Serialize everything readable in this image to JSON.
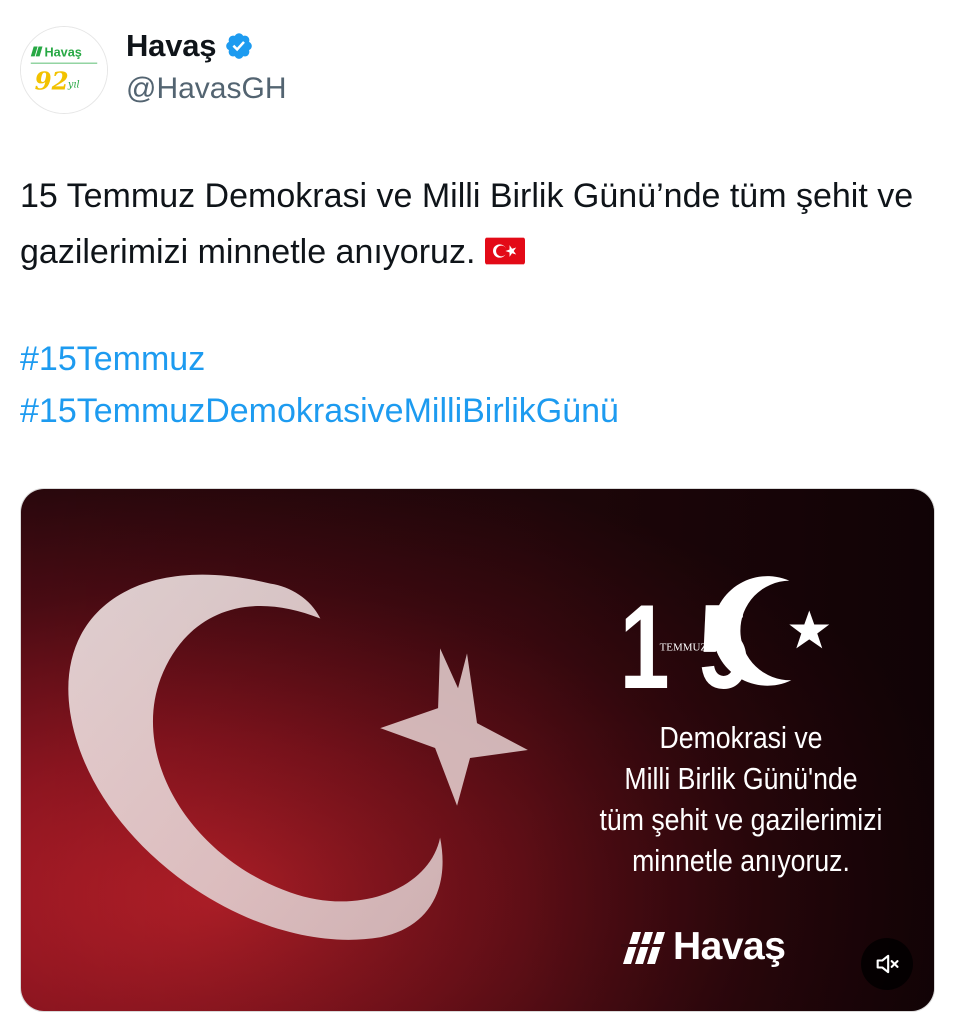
{
  "author": {
    "display_name": "Havaş",
    "handle": "@HavasGH",
    "verified_icon": "verified-badge-icon",
    "avatar": {
      "brand_text": "Havaş",
      "anniversary_number": "92",
      "anniversary_suffix": "yıl"
    }
  },
  "tweet": {
    "text": "15 Temmuz Demokrasi ve Milli Birlik Günü’nde tüm şehit ve gazilerimizi minnetle anıyoruz.",
    "emoji_icon": "turkey-flag-icon",
    "hashtags": [
      "#15Temmuz",
      "#15TemmuzDemokrasiveMilliBirlikGünü"
    ]
  },
  "media": {
    "logo_number_left": "1",
    "logo_number_right": "5",
    "logo_word": "TEMMUZ",
    "lines": [
      "Demokrasi ve",
      "Milli Birlik Günü'nde",
      "tüm şehit ve gazilerimizi",
      "minnetle anıyoruz."
    ],
    "brand_name": "Havaş",
    "mute_icon": "volume-muted-icon"
  },
  "colors": {
    "link": "#1d9bf0",
    "text": "#0f1419",
    "secondary_text": "#536471",
    "verified": "#1d9bf0",
    "flag_red": "#e30a17",
    "media_dark": "#2a0a10",
    "media_red": "#9a1420"
  }
}
